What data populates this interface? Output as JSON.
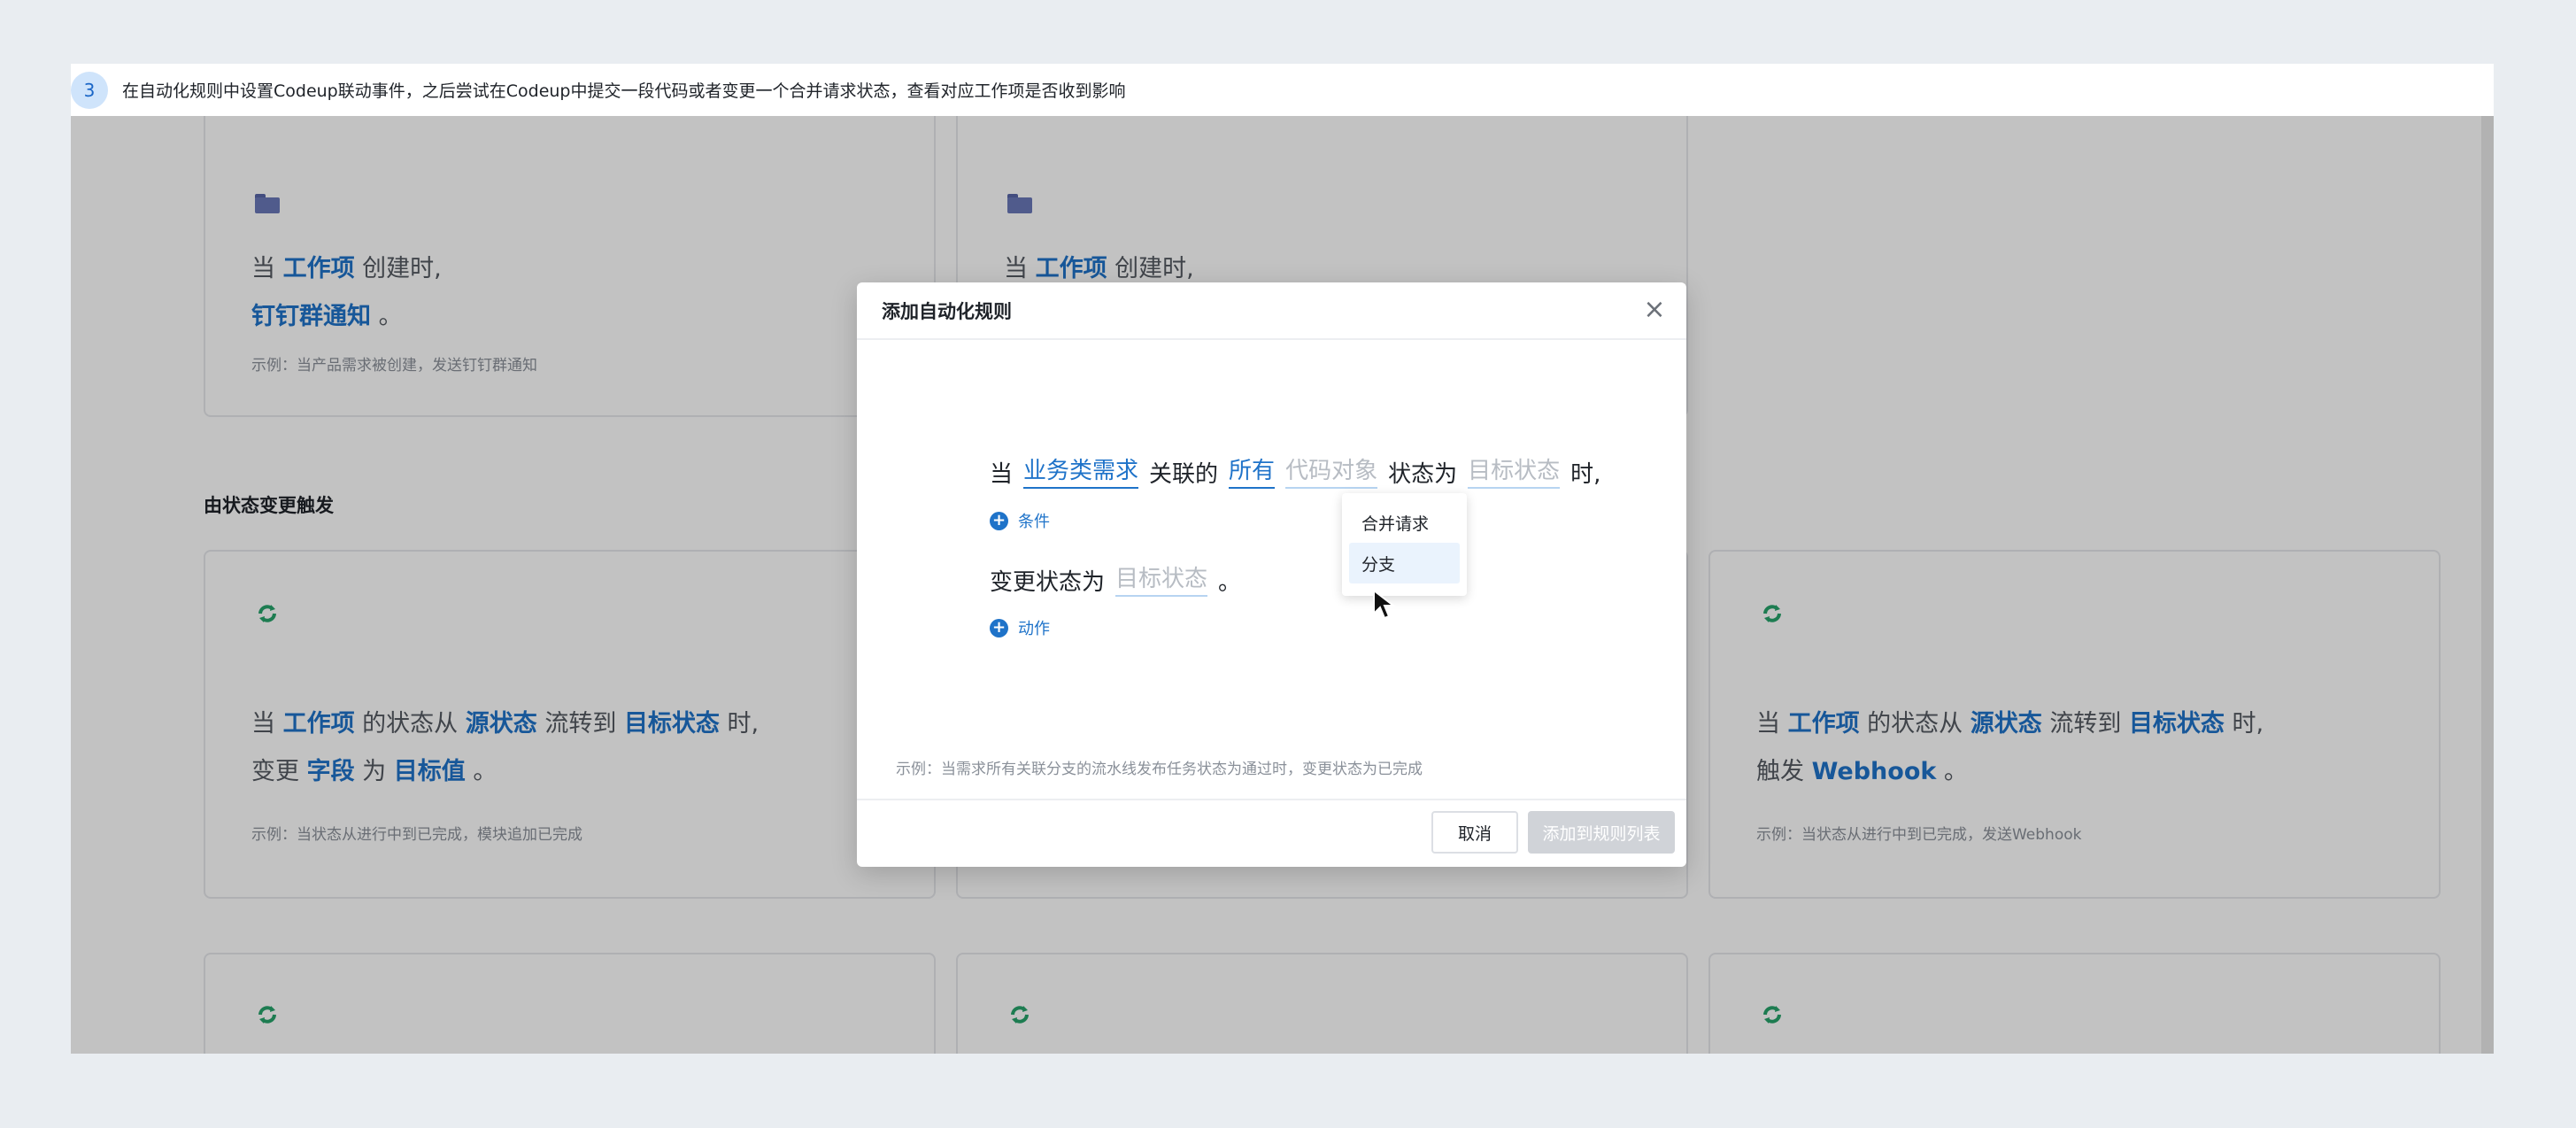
{
  "step": {
    "number": "3",
    "text": "在自动化规则中设置Codeup联动事件，之后尝试在Codeup中提交一段代码或者变更一个合并请求状态，查看对应工作项是否收到影响"
  },
  "cards_top": [
    {
      "line1": [
        "当 ",
        "工作项",
        " 创建时,"
      ],
      "line2": [
        "钉钉群通知",
        " 。"
      ],
      "example": "示例：当产品需求被创建，发送钉钉群通知"
    },
    {
      "line1": [
        "当 ",
        "工作项",
        " 创建时,"
      ]
    }
  ],
  "section_title": "由状态变更触发",
  "cards_status": [
    {
      "line1": [
        "当 ",
        "工作项",
        " 的状态从 ",
        "源状态",
        " 流转到 ",
        "目标状态",
        " 时,"
      ],
      "line2": [
        "变更 ",
        "字段",
        " 为 ",
        "目标值",
        " 。"
      ],
      "example": "示例：当状态从进行中到已完成，模块追加已完成"
    },
    {
      "line1": [
        "当 ",
        "工作项",
        " 的状态从 ",
        "源状态",
        " 流转到 ",
        "目标状态",
        " 时,"
      ],
      "line2": [
        "触发 ",
        "Webhook",
        " 。"
      ],
      "example": "示例：当状态从进行中到已完成，发送Webhook"
    }
  ],
  "modal": {
    "title": "添加自动化规则",
    "close_icon": "close-icon",
    "rule": {
      "when": "当",
      "work_item_type": "业务类需求",
      "related": "关联的",
      "scope": "所有",
      "code_object_placeholder": "代码对象",
      "status_is": "状态为",
      "target_status_placeholder": "目标状态",
      "tail": "时,"
    },
    "add_condition": "条件",
    "action": {
      "change_status_to": "变更状态为",
      "target_status_placeholder": "目标状态",
      "period": "。"
    },
    "add_action": "动作",
    "example": "示例：当需求所有关联分支的流水线发布任务状态为通过时，变更状态为已完成",
    "cancel_label": "取消",
    "add_label": "添加到规则列表"
  },
  "dropdown": {
    "options": [
      "合并请求",
      "分支"
    ],
    "hovered": "分支"
  },
  "colors": {
    "accent": "#1f73c9",
    "sync_icon": "#27a36b",
    "folder_icon": "#6a78b8"
  }
}
